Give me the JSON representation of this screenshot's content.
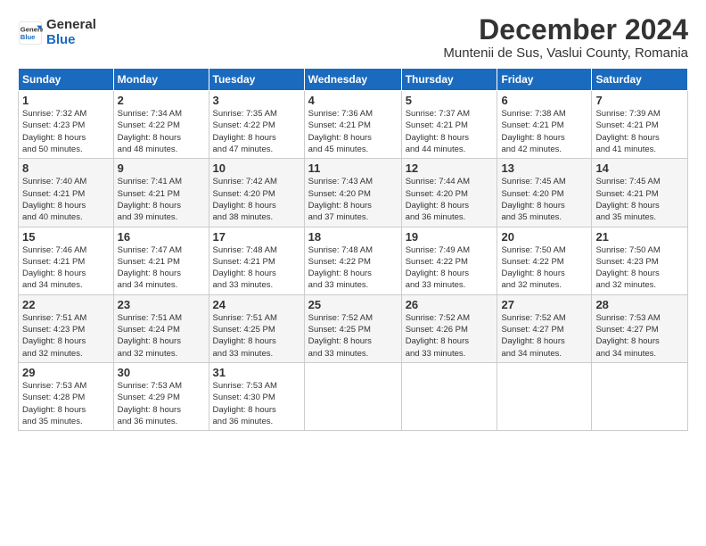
{
  "logo": {
    "line1": "General",
    "line2": "Blue"
  },
  "title": "December 2024",
  "subtitle": "Muntenii de Sus, Vaslui County, Romania",
  "days_header": [
    "Sunday",
    "Monday",
    "Tuesday",
    "Wednesday",
    "Thursday",
    "Friday",
    "Saturday"
  ],
  "weeks": [
    [
      {
        "day": "1",
        "info": "Sunrise: 7:32 AM\nSunset: 4:23 PM\nDaylight: 8 hours\nand 50 minutes."
      },
      {
        "day": "2",
        "info": "Sunrise: 7:34 AM\nSunset: 4:22 PM\nDaylight: 8 hours\nand 48 minutes."
      },
      {
        "day": "3",
        "info": "Sunrise: 7:35 AM\nSunset: 4:22 PM\nDaylight: 8 hours\nand 47 minutes."
      },
      {
        "day": "4",
        "info": "Sunrise: 7:36 AM\nSunset: 4:21 PM\nDaylight: 8 hours\nand 45 minutes."
      },
      {
        "day": "5",
        "info": "Sunrise: 7:37 AM\nSunset: 4:21 PM\nDaylight: 8 hours\nand 44 minutes."
      },
      {
        "day": "6",
        "info": "Sunrise: 7:38 AM\nSunset: 4:21 PM\nDaylight: 8 hours\nand 42 minutes."
      },
      {
        "day": "7",
        "info": "Sunrise: 7:39 AM\nSunset: 4:21 PM\nDaylight: 8 hours\nand 41 minutes."
      }
    ],
    [
      {
        "day": "8",
        "info": "Sunrise: 7:40 AM\nSunset: 4:21 PM\nDaylight: 8 hours\nand 40 minutes."
      },
      {
        "day": "9",
        "info": "Sunrise: 7:41 AM\nSunset: 4:21 PM\nDaylight: 8 hours\nand 39 minutes."
      },
      {
        "day": "10",
        "info": "Sunrise: 7:42 AM\nSunset: 4:20 PM\nDaylight: 8 hours\nand 38 minutes."
      },
      {
        "day": "11",
        "info": "Sunrise: 7:43 AM\nSunset: 4:20 PM\nDaylight: 8 hours\nand 37 minutes."
      },
      {
        "day": "12",
        "info": "Sunrise: 7:44 AM\nSunset: 4:20 PM\nDaylight: 8 hours\nand 36 minutes."
      },
      {
        "day": "13",
        "info": "Sunrise: 7:45 AM\nSunset: 4:20 PM\nDaylight: 8 hours\nand 35 minutes."
      },
      {
        "day": "14",
        "info": "Sunrise: 7:45 AM\nSunset: 4:21 PM\nDaylight: 8 hours\nand 35 minutes."
      }
    ],
    [
      {
        "day": "15",
        "info": "Sunrise: 7:46 AM\nSunset: 4:21 PM\nDaylight: 8 hours\nand 34 minutes."
      },
      {
        "day": "16",
        "info": "Sunrise: 7:47 AM\nSunset: 4:21 PM\nDaylight: 8 hours\nand 34 minutes."
      },
      {
        "day": "17",
        "info": "Sunrise: 7:48 AM\nSunset: 4:21 PM\nDaylight: 8 hours\nand 33 minutes."
      },
      {
        "day": "18",
        "info": "Sunrise: 7:48 AM\nSunset: 4:22 PM\nDaylight: 8 hours\nand 33 minutes."
      },
      {
        "day": "19",
        "info": "Sunrise: 7:49 AM\nSunset: 4:22 PM\nDaylight: 8 hours\nand 33 minutes."
      },
      {
        "day": "20",
        "info": "Sunrise: 7:50 AM\nSunset: 4:22 PM\nDaylight: 8 hours\nand 32 minutes."
      },
      {
        "day": "21",
        "info": "Sunrise: 7:50 AM\nSunset: 4:23 PM\nDaylight: 8 hours\nand 32 minutes."
      }
    ],
    [
      {
        "day": "22",
        "info": "Sunrise: 7:51 AM\nSunset: 4:23 PM\nDaylight: 8 hours\nand 32 minutes."
      },
      {
        "day": "23",
        "info": "Sunrise: 7:51 AM\nSunset: 4:24 PM\nDaylight: 8 hours\nand 32 minutes."
      },
      {
        "day": "24",
        "info": "Sunrise: 7:51 AM\nSunset: 4:25 PM\nDaylight: 8 hours\nand 33 minutes."
      },
      {
        "day": "25",
        "info": "Sunrise: 7:52 AM\nSunset: 4:25 PM\nDaylight: 8 hours\nand 33 minutes."
      },
      {
        "day": "26",
        "info": "Sunrise: 7:52 AM\nSunset: 4:26 PM\nDaylight: 8 hours\nand 33 minutes."
      },
      {
        "day": "27",
        "info": "Sunrise: 7:52 AM\nSunset: 4:27 PM\nDaylight: 8 hours\nand 34 minutes."
      },
      {
        "day": "28",
        "info": "Sunrise: 7:53 AM\nSunset: 4:27 PM\nDaylight: 8 hours\nand 34 minutes."
      }
    ],
    [
      {
        "day": "29",
        "info": "Sunrise: 7:53 AM\nSunset: 4:28 PM\nDaylight: 8 hours\nand 35 minutes."
      },
      {
        "day": "30",
        "info": "Sunrise: 7:53 AM\nSunset: 4:29 PM\nDaylight: 8 hours\nand 36 minutes."
      },
      {
        "day": "31",
        "info": "Sunrise: 7:53 AM\nSunset: 4:30 PM\nDaylight: 8 hours\nand 36 minutes."
      },
      null,
      null,
      null,
      null
    ]
  ]
}
